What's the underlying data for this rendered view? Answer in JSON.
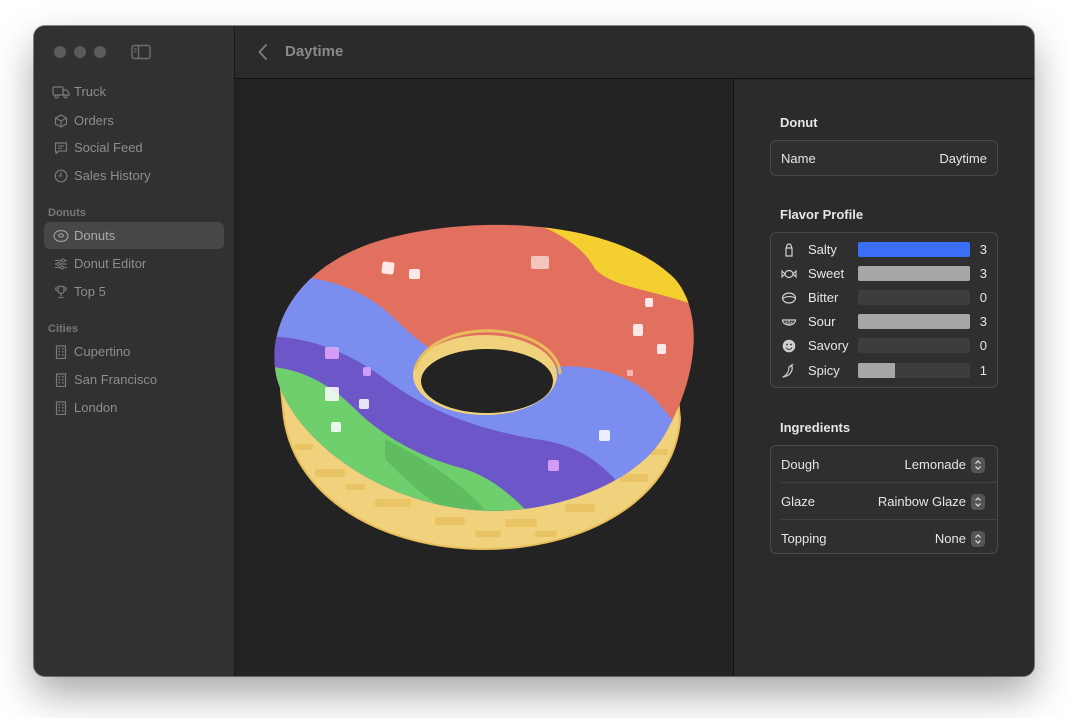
{
  "window": {
    "title": "Daytime"
  },
  "sidebar": {
    "items": [
      {
        "label": "Truck",
        "icon": "truck-icon"
      },
      {
        "label": "Orders",
        "icon": "box-icon"
      },
      {
        "label": "Social Feed",
        "icon": "message-icon"
      },
      {
        "label": "Sales History",
        "icon": "clock-icon"
      }
    ],
    "donuts_section": "Donuts",
    "donut_items": [
      {
        "label": "Donuts",
        "icon": "donut-icon",
        "selected": true
      },
      {
        "label": "Donut Editor",
        "icon": "sliders-icon"
      },
      {
        "label": "Top 5",
        "icon": "trophy-icon"
      }
    ],
    "cities_section": "Cities",
    "city_items": [
      {
        "label": "Cupertino",
        "icon": "building-icon"
      },
      {
        "label": "San Francisco",
        "icon": "building-icon"
      },
      {
        "label": "London",
        "icon": "building-icon"
      }
    ]
  },
  "inspector": {
    "donut_title": "Donut",
    "name_label": "Name",
    "name_value": "Daytime",
    "flavor_title": "Flavor Profile",
    "flavors": [
      {
        "name": "Salty",
        "value": "3",
        "level": 1.0,
        "icon": "salt-shaker-icon",
        "highlighted": true
      },
      {
        "name": "Sweet",
        "value": "3",
        "level": 1.0,
        "icon": "candy-icon"
      },
      {
        "name": "Bitter",
        "value": "0",
        "level": 0.0,
        "icon": "leaf-icon"
      },
      {
        "name": "Sour",
        "value": "3",
        "level": 1.0,
        "icon": "citrus-icon"
      },
      {
        "name": "Savory",
        "value": "0",
        "level": 0.0,
        "icon": "smiley-icon"
      },
      {
        "name": "Spicy",
        "value": "1",
        "level": 0.333,
        "icon": "chili-icon"
      }
    ],
    "ingredients_title": "Ingredients",
    "ingredients": [
      {
        "label": "Dough",
        "value": "Lemonade"
      },
      {
        "label": "Glaze",
        "value": "Rainbow Glaze"
      },
      {
        "label": "Topping",
        "value": "None"
      }
    ]
  },
  "colors": {
    "accent": "#3a6ef5",
    "bar": "#a7a7a7"
  }
}
